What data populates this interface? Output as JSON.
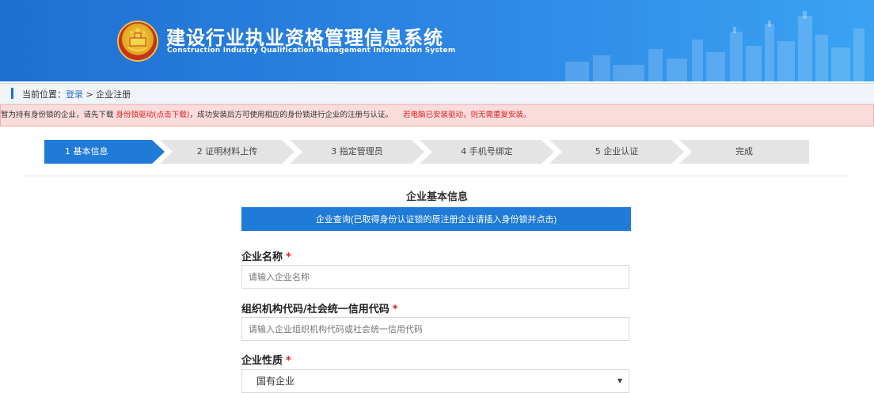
{
  "header": {
    "title_cn": "建设行业执业资格管理信息系统",
    "title_en": "Construction Industry Qualification Management Information System",
    "colors": {
      "primary": "#1f6fd1",
      "accent_red": "#e02020"
    }
  },
  "breadcrumb": {
    "prefix": "当前位置：",
    "link": "登录",
    "separator": " > ",
    "current": "企业注册"
  },
  "notice": {
    "part1": "暂为持有身份锁的企业，请先下载 ",
    "link": "身份锁驱动(点击下载)",
    "part2": "，成功安装后方可使用相应的身份锁进行企业的注册与认证。",
    "warning": "若电脑已安装驱动，则无需重复安装。"
  },
  "steps": [
    {
      "label": "1 基本信息",
      "active": true
    },
    {
      "label": "2 证明材料上传",
      "active": false
    },
    {
      "label": "3 指定管理员",
      "active": false
    },
    {
      "label": "4 手机号绑定",
      "active": false
    },
    {
      "label": "5 企业认证",
      "active": false
    },
    {
      "label": "完成",
      "active": false
    }
  ],
  "form": {
    "title": "企业基本信息",
    "query_button": "企业查询(已取得身份认证锁的原注册企业请插入身份锁并点击)",
    "company_name": {
      "label": "企业名称",
      "required": "*",
      "placeholder": "请输入企业名称"
    },
    "credit_code": {
      "label": "组织机构代码/社会统一信用代码",
      "required": "*",
      "placeholder": "请输入企业组织机构代码或社会统一信用代码"
    },
    "nature": {
      "label": "企业性质",
      "required": "*",
      "value": "国有企业",
      "arrow_icon": "caret-down-icon"
    }
  }
}
